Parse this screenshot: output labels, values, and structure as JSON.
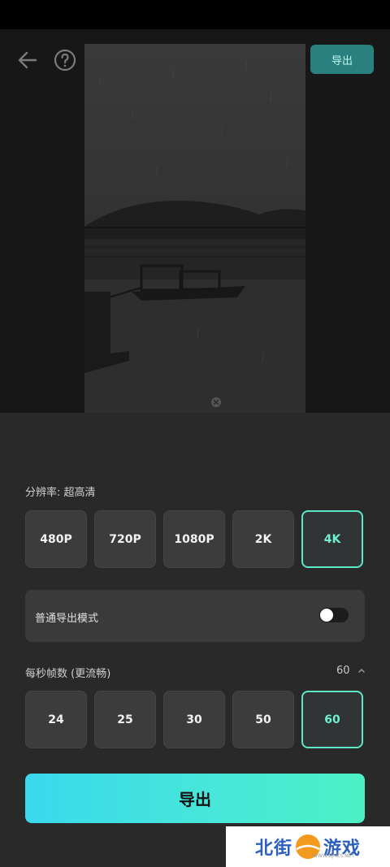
{
  "header": {
    "export_label": "导出",
    "back_icon": "arrow-left-icon",
    "help_icon": "question-circle-icon"
  },
  "resolution": {
    "label": "分辨率: 超高清",
    "options": [
      "480P",
      "720P",
      "1080P",
      "2K",
      "4K"
    ],
    "selected": "4K"
  },
  "mode": {
    "label": "普通导出模式",
    "enabled": false
  },
  "fps": {
    "label": "每秒帧数 (更流畅)",
    "value": "60",
    "options": [
      "24",
      "25",
      "30",
      "50",
      "60"
    ],
    "selected": "60"
  },
  "export_button": {
    "label": "导出"
  },
  "watermark": {
    "left": "北街",
    "right": "游戏",
    "sub": "WWW.BJHKS.NET"
  },
  "colors": {
    "accent": "#5ce8c8",
    "panel": "#292929",
    "export_top_bg": "#2a7f7f"
  }
}
